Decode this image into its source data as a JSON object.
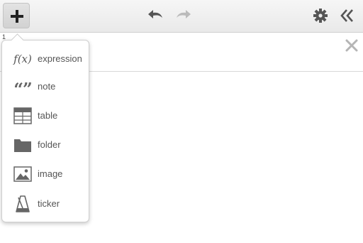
{
  "toolbar": {
    "add_icon": "plus-icon",
    "undo_icon": "undo-icon",
    "redo_icon": "redo-icon",
    "settings_icon": "gear-icon",
    "collapse_icon": "double-chevron-left-icon"
  },
  "expression_list": {
    "row_index": "1",
    "close_icon": "close-icon"
  },
  "add_menu": {
    "items": [
      {
        "label": "expression",
        "icon": "function-icon",
        "icon_text": "f(x)"
      },
      {
        "label": "note",
        "icon": "quote-icon",
        "icon_text": "“”"
      },
      {
        "label": "table",
        "icon": "table-icon"
      },
      {
        "label": "folder",
        "icon": "folder-icon"
      },
      {
        "label": "image",
        "icon": "image-icon"
      },
      {
        "label": "ticker",
        "icon": "metronome-icon"
      }
    ]
  },
  "colors": {
    "toolbar_bg": "#ececec",
    "icon_gray": "#666666",
    "icon_disabled": "#bbbbbb",
    "text_gray": "#555555"
  }
}
